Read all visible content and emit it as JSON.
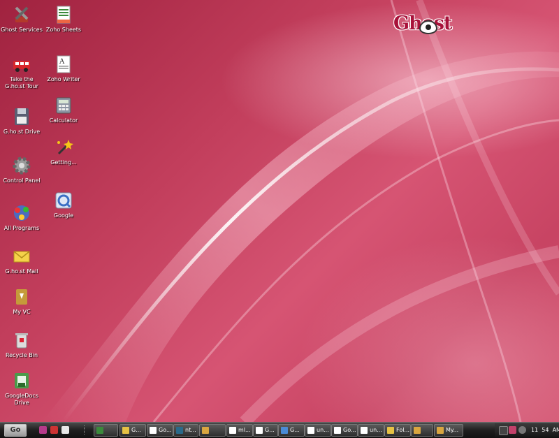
{
  "brand": {
    "logo_text": "Ghost",
    "accent": "#a8123a"
  },
  "desktop": {
    "background": "#c23e5c",
    "icons_col1": [
      {
        "label": "Ghost Services",
        "icon": "tools-icon"
      },
      {
        "label": "Take the G.ho.st Tour",
        "icon": "tour-bus-icon"
      },
      {
        "label": "G.ho.st Drive",
        "icon": "floppy-drive-icon"
      },
      {
        "label": "Control Panel",
        "icon": "gear-icon"
      },
      {
        "label": "All Programs",
        "icon": "programs-icon"
      },
      {
        "label": "G.ho.st Mail",
        "icon": "mail-envelope-icon"
      },
      {
        "label": "My VC",
        "icon": "my-vc-icon"
      },
      {
        "label": "Recycle Bin",
        "icon": "recycle-bin-icon"
      },
      {
        "label": "GoogleDocs Drive",
        "icon": "googledocs-drive-icon"
      }
    ],
    "icons_col2": [
      {
        "label": "Zoho Sheets",
        "icon": "spreadsheet-icon"
      },
      {
        "label": "Zoho Writer",
        "icon": "document-icon"
      },
      {
        "label": "Calculator",
        "icon": "calculator-icon"
      },
      {
        "label": "Getting...",
        "icon": "magic-wand-icon"
      },
      {
        "label": "Google",
        "icon": "google-icon"
      }
    ]
  },
  "taskbar": {
    "start_label": "Go",
    "buttons": [
      {
        "label": "",
        "icon": "sheet-icon",
        "color": "#3b8a3b"
      },
      {
        "label": "G...",
        "icon": "folder-icon",
        "color": "#e6c244"
      },
      {
        "label": "Go...",
        "icon": "doc-icon",
        "color": "#ffffff"
      },
      {
        "label": "nt...",
        "icon": "terminal-icon",
        "color": "#2a6a8a"
      },
      {
        "label": "",
        "icon": "tools-icon",
        "color": "#d9a640"
      },
      {
        "label": "ml...",
        "icon": "doc-icon",
        "color": "#ffffff"
      },
      {
        "label": "G...",
        "icon": "doc-icon",
        "color": "#ffffff"
      },
      {
        "label": "G...",
        "icon": "google-icon",
        "color": "#4a8bd6"
      },
      {
        "label": "un...",
        "icon": "doc-icon",
        "color": "#ffffff"
      },
      {
        "label": "Go...",
        "icon": "doc-icon",
        "color": "#ffffff"
      },
      {
        "label": "un...",
        "icon": "doc-icon",
        "color": "#ffffff"
      },
      {
        "label": "Fol...",
        "icon": "folder-icon",
        "color": "#e6c244"
      },
      {
        "label": "",
        "icon": "tools-icon",
        "color": "#d9a640"
      },
      {
        "label": "My...",
        "icon": "vc-icon",
        "color": "#d9a640"
      }
    ],
    "clock": {
      "hour": "11",
      "minute": "54",
      "ampm": "AM"
    }
  }
}
